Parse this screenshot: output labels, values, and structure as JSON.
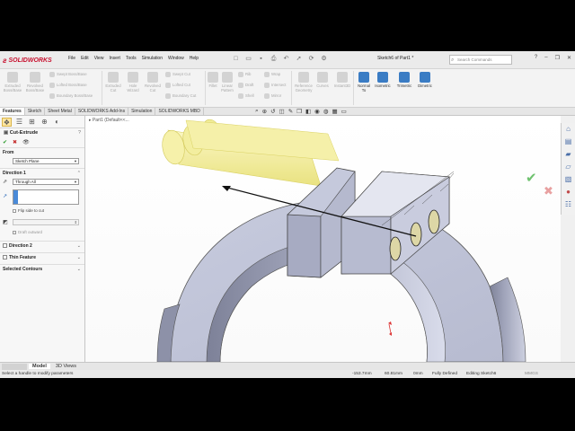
{
  "app": {
    "brand": "SOLIDWORKS",
    "menu": [
      "File",
      "Edit",
      "View",
      "Insert",
      "Tools",
      "Simulation",
      "Window",
      "Help"
    ],
    "doc_title": "Sketch6 of Part1 *",
    "search_placeholder": "Search Commands"
  },
  "commands": {
    "extruded_boss": "Extruded Boss/Base",
    "revolved_boss": "Revolved Boss/Base",
    "swept_boss": "Swept Boss/Base",
    "lofted_boss": "Lofted Boss/Base",
    "boundary_boss": "Boundary Boss/Base",
    "extruded_cut": "Extruded Cut",
    "hole_wizard": "Hole Wizard",
    "revolved_cut": "Revolved Cut",
    "swept_cut": "Swept Cut",
    "lofted_cut": "Lofted Cut",
    "boundary_cut": "Boundary Cut",
    "fillet": "Fillet",
    "linear_pattern": "Linear Pattern",
    "rib": "Rib",
    "draft": "Draft",
    "shell": "Shell",
    "wrap": "Wrap",
    "intersect": "Intersect",
    "mirror": "Mirror",
    "reference_geometry": "Reference Geometry",
    "curves": "Curves",
    "instant3d": "Instant3D",
    "normal_to": "Normal To",
    "isometric": "Isometric",
    "trimetric": "Trimetric",
    "dimetric": "Dimetric"
  },
  "tabs": [
    "Features",
    "Sketch",
    "Sheet Metal",
    "SOLIDWORKS Add-Ins",
    "Simulation",
    "SOLIDWORKS MBD"
  ],
  "property_manager": {
    "title": "Cut-Extrude",
    "from_label": "From",
    "from_value": "Sketch Plane",
    "direction1_label": "Direction 1",
    "end_condition": "Through All",
    "flip_side": "Flip side to cut",
    "draft_outward": "Draft outward",
    "direction2_label": "Direction 2",
    "thin_feature_label": "Thin Feature",
    "selected_contours_label": "Selected Contours"
  },
  "graphics": {
    "breadcrumb": "Part1 (Default<<..."
  },
  "bottom_tabs": [
    "Model",
    "3D Views"
  ],
  "status": {
    "hint": "Select a handle to modify parameters",
    "x": "-153.7mm",
    "y": "60.81mm",
    "z": "0mm",
    "state": "Fully Defined",
    "editing": "Editing Sketch6",
    "units": "MMGS"
  },
  "colors": {
    "part_body": "#c8cce0",
    "part_shadow": "#8a8ea8",
    "preview": "#f4ef9a",
    "accent": "#c8102e"
  }
}
